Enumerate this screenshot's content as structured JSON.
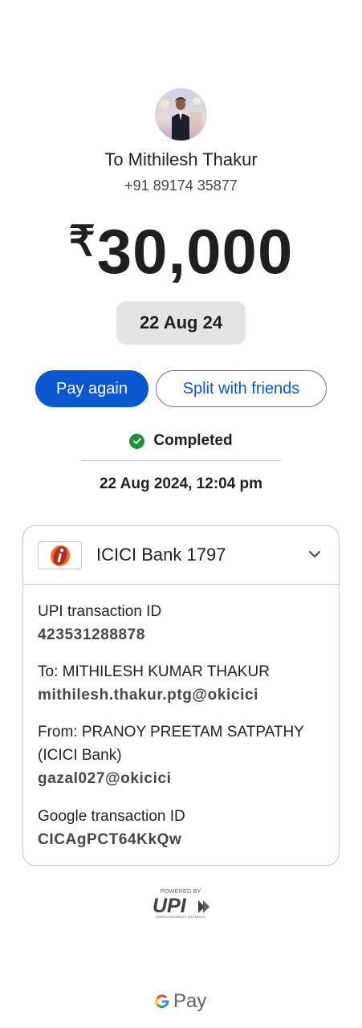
{
  "recipient": {
    "name": "To Mithilesh Thakur",
    "phone": "+91 89174 35877"
  },
  "payment": {
    "currency_symbol": "₹",
    "amount": "30,000",
    "date_chip": "22 Aug 24"
  },
  "actions": {
    "pay_again": "Pay again",
    "split": "Split with friends"
  },
  "status": {
    "text": "Completed",
    "timestamp": "22 Aug 2024, 12:04 pm",
    "color": "#1e8e3e"
  },
  "bank": {
    "name": "ICICI Bank 1797"
  },
  "details": [
    {
      "label": "UPI transaction ID",
      "value": "423531288878"
    },
    {
      "label": "To: MITHILESH KUMAR THAKUR",
      "value": "mithilesh.thakur.ptg@okicici"
    },
    {
      "label": "From: PRANOY PREETAM SATPATHY (ICICI Bank)",
      "value": "gazal027@okicici"
    },
    {
      "label": "Google transaction ID",
      "value": "CICAgPCT64KkQw"
    }
  ],
  "footer": {
    "powered_by": "POWERED BY",
    "upi": "UPI",
    "upi_sub": "UNIFIED PAYMENTS INTERFACE",
    "gpay": "Pay"
  },
  "icons": [
    "avatar",
    "check-circle-icon",
    "icici-logo-icon",
    "chevron-down-icon",
    "upi-logo",
    "google-g-icon"
  ],
  "colors": {
    "accent": "#0b57d0",
    "success": "#1e8e3e",
    "chip": "#e3e5e3"
  }
}
